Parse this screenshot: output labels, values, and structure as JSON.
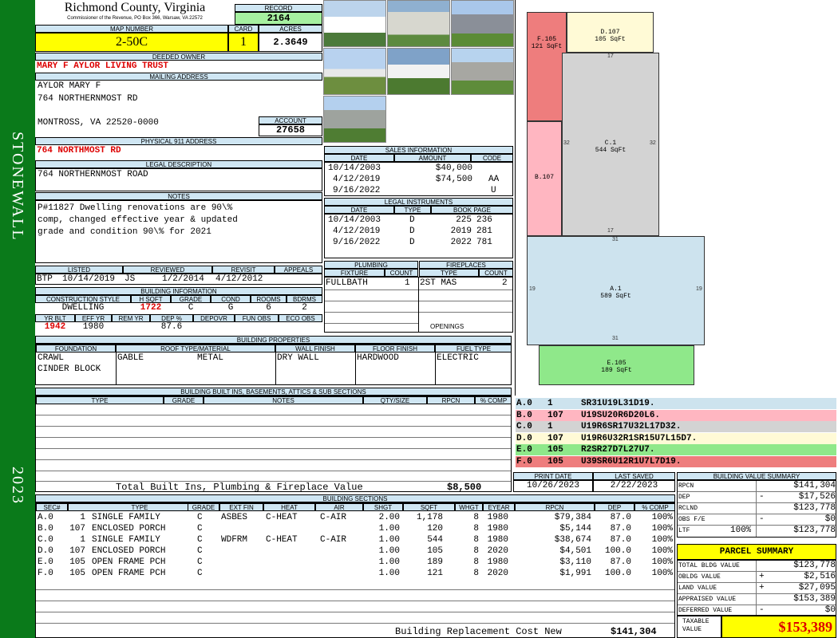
{
  "district": "STONEWALL",
  "year": "2023",
  "header": {
    "county": "Richmond County, Virginia",
    "commissioner": "Commissioner of the Revenue, PO Box 366, Warsaw, VA 22572",
    "record_label": "RECORD",
    "record": "2164",
    "map_label": "MAP NUMBER",
    "map_number": "2-50C",
    "card_label": "CARD",
    "card": "1",
    "acres_label": "ACRES",
    "acres": "2.3649"
  },
  "owner": {
    "deeded_label": "DEEDED OWNER",
    "deeded": "MARY F AYLOR LIVING TRUST",
    "mailing_label": "MAILING ADDRESS",
    "mailing_line1": "AYLOR MARY F",
    "mailing_line2": "764 NORTHERNMOST RD",
    "mailing_line3": "MONTROSS, VA 22520-0000",
    "account_label": "ACCOUNT",
    "account": "27658",
    "physical_label": "PHYSICAL 911 ADDRESS",
    "physical": "764 NORTHMOST RD"
  },
  "legal": {
    "label": "LEGAL DESCRIPTION",
    "text": "764 NORTHERNMOST ROAD"
  },
  "notes": {
    "label": "NOTES",
    "line1": "P#11827 Dwelling renovations are 90\\%",
    "line2": "comp, changed effective year & updated",
    "line3": "grade and condition 90\\% for 2021"
  },
  "listing": {
    "listed_label": "LISTED",
    "reviewed_label": "REVIEWED",
    "revisit_label": "REVISIT",
    "appeals_label": "APPEALS",
    "listed_by": "BTP",
    "listed": "10/14/2019",
    "reviewed_by": "JS",
    "reviewed": "1/2/2014",
    "revisit": "4/12/2012"
  },
  "building_info": {
    "label": "BUILDING INFORMATION",
    "h": [
      "CONSTRUCTION STYLE",
      "H SQFT",
      "GRADE",
      "COND",
      "ROOMS",
      "BDRMS"
    ],
    "style": "DWELLING",
    "hsqft": "1722",
    "grade": "C",
    "cond": "G",
    "rooms": "6",
    "bdrms": "2",
    "h2": [
      "YR BLT",
      "EFF YR",
      "REM YR",
      "DEP %",
      "DEPOVR",
      "FUN OBS",
      "ECO OBS"
    ],
    "yrblt": "1942",
    "effyr": "1980",
    "dep": "87.6"
  },
  "sales": {
    "label": "SALES INFORMATION",
    "h": [
      "DATE",
      "AMOUNT",
      "CODE"
    ],
    "rows": [
      {
        "date": "10/14/2003",
        "amount": "$40,000",
        "code": ""
      },
      {
        "date": "4/12/2019",
        "amount": "$74,500",
        "code": "AA"
      },
      {
        "date": "9/16/2022",
        "amount": "",
        "code": "U"
      }
    ]
  },
  "instruments": {
    "label": "LEGAL INSTRUMENTS",
    "h": [
      "DATE",
      "TYPE",
      "BOOK PAGE"
    ],
    "rows": [
      {
        "date": "10/14/2003",
        "type": "D",
        "book": "225",
        "page": "236"
      },
      {
        "date": "4/12/2019",
        "type": "D",
        "book": "2019",
        "page": "281"
      },
      {
        "date": "9/16/2022",
        "type": "D",
        "book": "2022",
        "page": "781"
      }
    ]
  },
  "plumbing": {
    "label": "PLUMBING",
    "h": [
      "FIXTURE",
      "COUNT"
    ],
    "fixture": "FULLBATH",
    "count": "1"
  },
  "fireplaces": {
    "label": "FIREPLACES",
    "h": [
      "TYPE",
      "COUNT"
    ],
    "type": "2ST MAS",
    "count": "2",
    "openings_label": "OPENINGS"
  },
  "properties": {
    "label": "BUILDING PROPERTIES",
    "h": [
      "FOUNDATION",
      "ROOF TYPE/MATERIAL",
      "WALL FINISH",
      "FLOOR FINISH",
      "FUEL TYPE"
    ],
    "foundation1": "CRAWL",
    "foundation2": "CINDER BLOCK",
    "roof_type": "GABLE",
    "roof_mat": "METAL",
    "wall": "DRY WALL",
    "floor": "HARDWOOD",
    "fuel": "ELECTRIC"
  },
  "builtins": {
    "label": "BUILDING BUILT INS, BASEMENTS, ATTICS & SUB SECTIONS",
    "h": [
      "TYPE",
      "GRADE",
      "NOTES",
      "QTY/SIZE",
      "RPCN",
      "% COMP"
    ],
    "total_label": "Total Built Ins, Plumbing & Fireplace Value",
    "total": "$8,500"
  },
  "dates": {
    "print_label": "PRINT DATE",
    "print": "10/26/2023",
    "saved_label": "LAST SAVED",
    "saved": "2/22/2023"
  },
  "sections": {
    "label": "BUILDING SECTIONS",
    "h": [
      "SEC#",
      "TYPE",
      "GRADE",
      "EXT FIN",
      "HEAT",
      "AIR",
      "SHGT",
      "SQFT",
      "WHGT",
      "EYEAR",
      "RPCN",
      "DEP",
      "% COMP"
    ],
    "rows": [
      {
        "sec": "A.0",
        "code": "1",
        "type": "SINGLE FAMILY",
        "grade": "C",
        "ext": "ASBES",
        "heat": "C-HEAT",
        "air": "C-AIR",
        "shgt": "2.00",
        "sqft": "1,178",
        "whgt": "8",
        "eyear": "1980",
        "rpcn": "$79,384",
        "dep": "87.0",
        "comp": "100%"
      },
      {
        "sec": "B.0",
        "code": "107",
        "type": "ENCLOSED PORCH",
        "grade": "C",
        "ext": "",
        "heat": "",
        "air": "",
        "shgt": "1.00",
        "sqft": "120",
        "whgt": "8",
        "eyear": "1980",
        "rpcn": "$5,144",
        "dep": "87.0",
        "comp": "100%"
      },
      {
        "sec": "C.0",
        "code": "1",
        "type": "SINGLE FAMILY",
        "grade": "C",
        "ext": "WDFRM",
        "heat": "C-HEAT",
        "air": "C-AIR",
        "shgt": "1.00",
        "sqft": "544",
        "whgt": "8",
        "eyear": "1980",
        "rpcn": "$38,674",
        "dep": "87.0",
        "comp": "100%"
      },
      {
        "sec": "D.0",
        "code": "107",
        "type": "ENCLOSED PORCH",
        "grade": "C",
        "ext": "",
        "heat": "",
        "air": "",
        "shgt": "1.00",
        "sqft": "105",
        "whgt": "8",
        "eyear": "2020",
        "rpcn": "$4,501",
        "dep": "100.0",
        "comp": "100%"
      },
      {
        "sec": "E.0",
        "code": "105",
        "type": "OPEN FRAME PCH",
        "grade": "C",
        "ext": "",
        "heat": "",
        "air": "",
        "shgt": "1.00",
        "sqft": "189",
        "whgt": "8",
        "eyear": "1980",
        "rpcn": "$3,110",
        "dep": "87.0",
        "comp": "100%"
      },
      {
        "sec": "F.0",
        "code": "105",
        "type": "OPEN FRAME PCH",
        "grade": "C",
        "ext": "",
        "heat": "",
        "air": "",
        "shgt": "1.00",
        "sqft": "121",
        "whgt": "8",
        "eyear": "2020",
        "rpcn": "$1,991",
        "dep": "100.0",
        "comp": "100%"
      }
    ],
    "replacement_label": "Building Replacement Cost New",
    "replacement": "$141,304"
  },
  "sketch": {
    "areas": [
      {
        "id": "F.105",
        "sqft": "121 SqFt"
      },
      {
        "id": "D.107",
        "sqft": "105 SqFt"
      },
      {
        "id": "C.1",
        "sqft": "544 SqFt"
      },
      {
        "id": "B.107",
        "sqft": ""
      },
      {
        "id": "A.1",
        "sqft": "589 SqFt"
      },
      {
        "id": "E.105",
        "sqft": "189 SqFt"
      }
    ],
    "dims": [
      "17",
      "32",
      "32",
      "17",
      "31",
      "19",
      "19",
      "31"
    ]
  },
  "legend": [
    {
      "sec": "A.0",
      "code": "1",
      "path": "SR31U19L31D19.",
      "color": "#cde3ee"
    },
    {
      "sec": "B.0",
      "code": "107",
      "path": "U19SU20R6D20L6.",
      "color": "#ffb6c1"
    },
    {
      "sec": "C.0",
      "code": "1",
      "path": "U19R6SR17U32L17D32.",
      "color": "#d3d3d3"
    },
    {
      "sec": "D.0",
      "code": "107",
      "path": "U19R6U32R1SR15U7L15D7.",
      "color": "#fffad6"
    },
    {
      "sec": "E.0",
      "code": "105",
      "path": "R2SR27D7L27U7.",
      "color": "#8fe88a"
    },
    {
      "sec": "F.0",
      "code": "105",
      "path": "U39SR6U12R1U7L7D19.",
      "color": "#ee7d7d"
    }
  ],
  "value_summary": {
    "label": "BUILDING VALUE SUMMARY",
    "rpcn_label": "RPCN",
    "rpcn": "$141,304",
    "dep_label": "DEP",
    "dep_sign": "-",
    "dep": "$17,526",
    "rclnd_label": "RCLND",
    "rclnd": "$123,778",
    "obs_label": "OBS F/E",
    "obs_sign": "-",
    "obs": "$0",
    "ltf_label": "LTF",
    "ltf_pct": "100%",
    "ltf": "$123,778"
  },
  "parcel": {
    "label": "PARCEL SUMMARY",
    "total_bldg_label": "TOTAL BLDG VALUE",
    "total_bldg": "$123,778",
    "obldg_label": "OBLDG VALUE",
    "obldg_sign": "+",
    "obldg": "$2,516",
    "land_label": "LAND VALUE",
    "land_sign": "+",
    "land": "$27,095",
    "appraised_label": "APPRAISED VALUE",
    "appraised": "$153,389",
    "deferred_label": "DEFERRED VALUE",
    "deferred_sign": "-",
    "deferred": "$0",
    "taxable_label1": "TAXABLE",
    "taxable_label2": "VALUE",
    "taxable": "$153,389"
  }
}
